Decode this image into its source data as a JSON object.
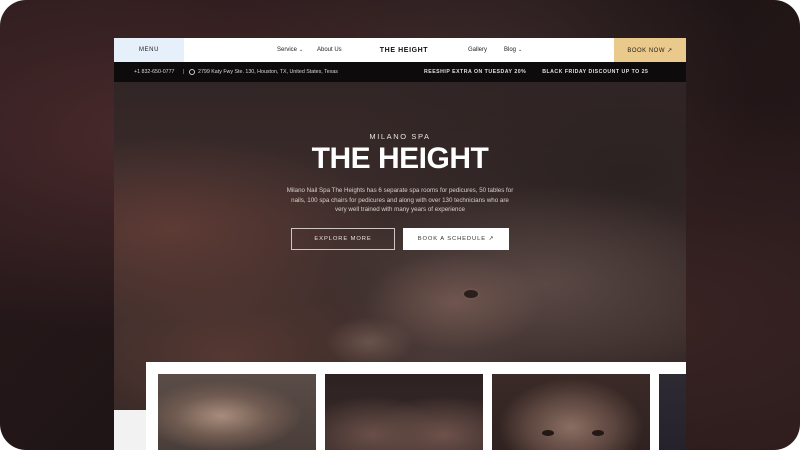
{
  "nav": {
    "menu_label": "MENU",
    "service_label": "Service",
    "about_label": "About Us",
    "logo_text": "THE HEIGHT",
    "gallery_label": "Gallery",
    "blog_label": "Blog",
    "book_now_label": "BOOK NOW ↗",
    "caret_glyph": "⌄"
  },
  "infobar": {
    "phone": "+1 832-650-0777",
    "separator": "|",
    "address": "2799 Katy Fwy Ste. 130, Houston, TX, United States, Texas",
    "ticker_items": [
      "REESHIP EXTRA ON TUESDAY 20%",
      "BLACK FRIDAY DISCOUNT UP TO 25"
    ]
  },
  "hero": {
    "eyebrow": "MILANO SPA",
    "title": "THE HEIGHT",
    "description": "Milano Nail Spa The Heights has 6 separate spa rooms for pedicures, 50 tables for nails, 100 spa chairs for pedicures and along with over 130 technicians who are very well trained with many years of experience",
    "explore_label": "EXPLORE MORE",
    "book_schedule_label": "BOOK A SCHEDULE ↗"
  },
  "colors": {
    "accent_gold": "#e9c98c",
    "menu_bg": "#e6f0fa",
    "infobar_bg": "#0d0b0b"
  }
}
